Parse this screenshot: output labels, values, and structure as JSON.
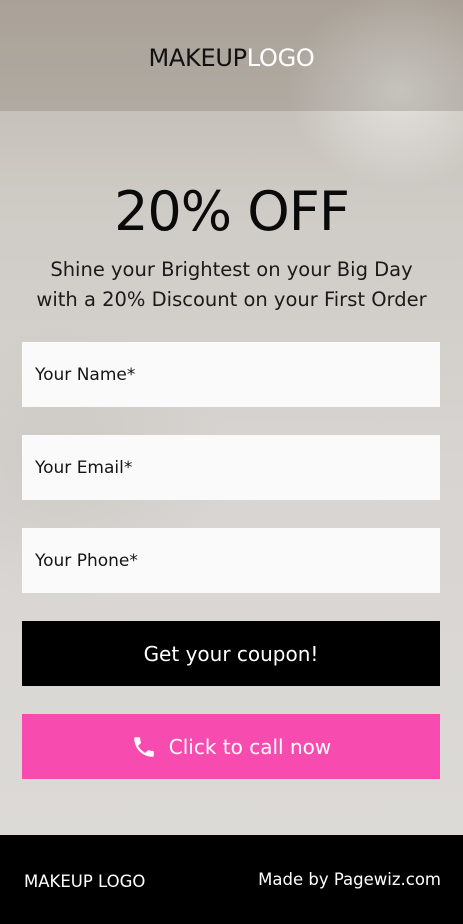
{
  "header": {
    "logo_dark": "MAKEUP",
    "logo_light": "LOGO"
  },
  "hero": {
    "headline": "20% OFF",
    "subline_1": "Shine your Brightest on your Big Day",
    "subline_2": "with a 20% Discount on your First Order"
  },
  "form": {
    "name_placeholder": "Your Name*",
    "email_placeholder": "Your Email*",
    "phone_placeholder": "Your Phone*",
    "submit_label": "Get your coupon!"
  },
  "call": {
    "label": "Click to call now",
    "icon": "phone-icon"
  },
  "footer": {
    "logo": "MAKEUP LOGO",
    "made_by": "Made by Pagewiz.com"
  },
  "colors": {
    "call_button": "#f74bb0",
    "submit_button": "#000000",
    "footer": "#000000"
  }
}
